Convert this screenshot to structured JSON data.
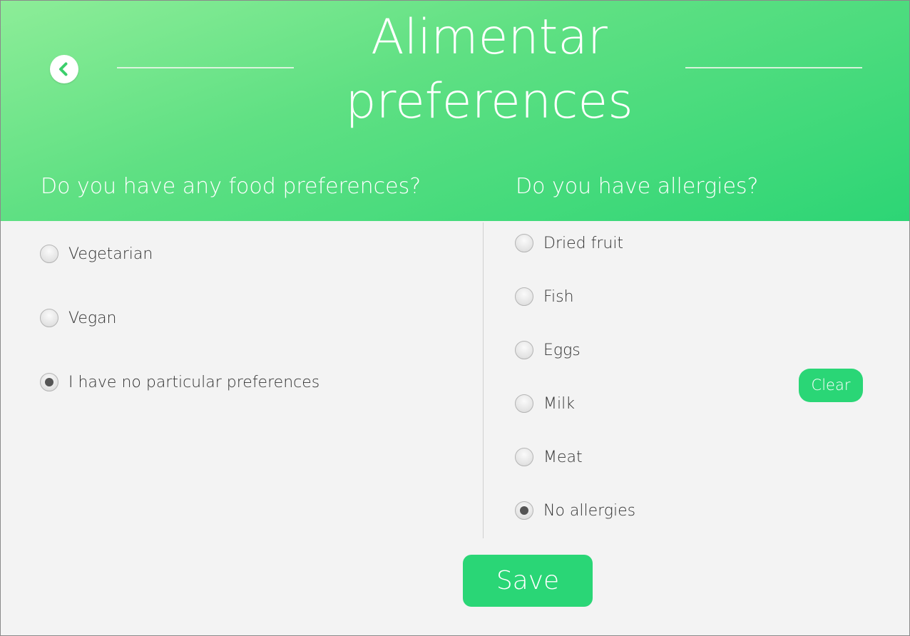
{
  "header": {
    "title_line1": "Alimentar",
    "title_line2": "preferences",
    "back_icon": "chevron-left-icon"
  },
  "food_preferences": {
    "question": "Do you have any food preferences?",
    "options": [
      {
        "label": "Vegetarian",
        "checked": false
      },
      {
        "label": "Vegan",
        "checked": false
      },
      {
        "label": "I have no particular preferences",
        "checked": true
      }
    ]
  },
  "allergies": {
    "question": "Do you have allergies?",
    "options": [
      {
        "label": "Dried fruit",
        "checked": false
      },
      {
        "label": "Fish",
        "checked": false
      },
      {
        "label": "Eggs",
        "checked": false
      },
      {
        "label": "Milk",
        "checked": false
      },
      {
        "label": "Meat",
        "checked": false
      },
      {
        "label": "No allergies",
        "checked": true
      }
    ],
    "clear_label": "Clear"
  },
  "actions": {
    "save_label": "Save"
  },
  "colors": {
    "accent": "#2ad676",
    "header_gradient_start": "#8ded98",
    "header_gradient_end": "#2dd575",
    "background": "#f3f3f3",
    "text": "#333333"
  }
}
